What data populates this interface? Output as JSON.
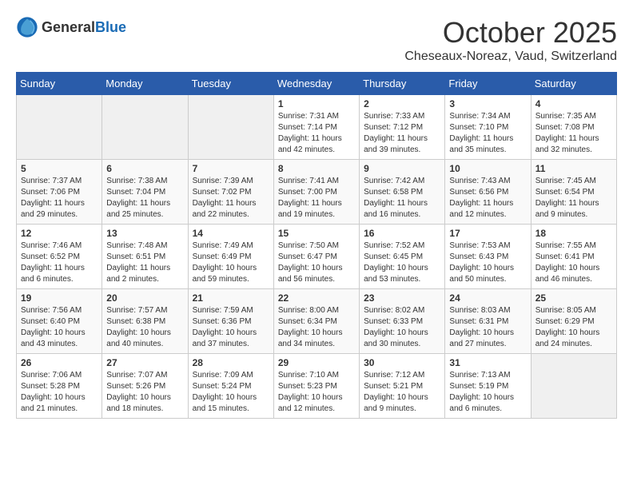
{
  "header": {
    "logo_general": "General",
    "logo_blue": "Blue",
    "month": "October 2025",
    "location": "Cheseaux-Noreaz, Vaud, Switzerland"
  },
  "weekdays": [
    "Sunday",
    "Monday",
    "Tuesday",
    "Wednesday",
    "Thursday",
    "Friday",
    "Saturday"
  ],
  "weeks": [
    [
      {
        "day": "",
        "info": ""
      },
      {
        "day": "",
        "info": ""
      },
      {
        "day": "",
        "info": ""
      },
      {
        "day": "1",
        "info": "Sunrise: 7:31 AM\nSunset: 7:14 PM\nDaylight: 11 hours\nand 42 minutes."
      },
      {
        "day": "2",
        "info": "Sunrise: 7:33 AM\nSunset: 7:12 PM\nDaylight: 11 hours\nand 39 minutes."
      },
      {
        "day": "3",
        "info": "Sunrise: 7:34 AM\nSunset: 7:10 PM\nDaylight: 11 hours\nand 35 minutes."
      },
      {
        "day": "4",
        "info": "Sunrise: 7:35 AM\nSunset: 7:08 PM\nDaylight: 11 hours\nand 32 minutes."
      }
    ],
    [
      {
        "day": "5",
        "info": "Sunrise: 7:37 AM\nSunset: 7:06 PM\nDaylight: 11 hours\nand 29 minutes."
      },
      {
        "day": "6",
        "info": "Sunrise: 7:38 AM\nSunset: 7:04 PM\nDaylight: 11 hours\nand 25 minutes."
      },
      {
        "day": "7",
        "info": "Sunrise: 7:39 AM\nSunset: 7:02 PM\nDaylight: 11 hours\nand 22 minutes."
      },
      {
        "day": "8",
        "info": "Sunrise: 7:41 AM\nSunset: 7:00 PM\nDaylight: 11 hours\nand 19 minutes."
      },
      {
        "day": "9",
        "info": "Sunrise: 7:42 AM\nSunset: 6:58 PM\nDaylight: 11 hours\nand 16 minutes."
      },
      {
        "day": "10",
        "info": "Sunrise: 7:43 AM\nSunset: 6:56 PM\nDaylight: 11 hours\nand 12 minutes."
      },
      {
        "day": "11",
        "info": "Sunrise: 7:45 AM\nSunset: 6:54 PM\nDaylight: 11 hours\nand 9 minutes."
      }
    ],
    [
      {
        "day": "12",
        "info": "Sunrise: 7:46 AM\nSunset: 6:52 PM\nDaylight: 11 hours\nand 6 minutes."
      },
      {
        "day": "13",
        "info": "Sunrise: 7:48 AM\nSunset: 6:51 PM\nDaylight: 11 hours\nand 2 minutes."
      },
      {
        "day": "14",
        "info": "Sunrise: 7:49 AM\nSunset: 6:49 PM\nDaylight: 10 hours\nand 59 minutes."
      },
      {
        "day": "15",
        "info": "Sunrise: 7:50 AM\nSunset: 6:47 PM\nDaylight: 10 hours\nand 56 minutes."
      },
      {
        "day": "16",
        "info": "Sunrise: 7:52 AM\nSunset: 6:45 PM\nDaylight: 10 hours\nand 53 minutes."
      },
      {
        "day": "17",
        "info": "Sunrise: 7:53 AM\nSunset: 6:43 PM\nDaylight: 10 hours\nand 50 minutes."
      },
      {
        "day": "18",
        "info": "Sunrise: 7:55 AM\nSunset: 6:41 PM\nDaylight: 10 hours\nand 46 minutes."
      }
    ],
    [
      {
        "day": "19",
        "info": "Sunrise: 7:56 AM\nSunset: 6:40 PM\nDaylight: 10 hours\nand 43 minutes."
      },
      {
        "day": "20",
        "info": "Sunrise: 7:57 AM\nSunset: 6:38 PM\nDaylight: 10 hours\nand 40 minutes."
      },
      {
        "day": "21",
        "info": "Sunrise: 7:59 AM\nSunset: 6:36 PM\nDaylight: 10 hours\nand 37 minutes."
      },
      {
        "day": "22",
        "info": "Sunrise: 8:00 AM\nSunset: 6:34 PM\nDaylight: 10 hours\nand 34 minutes."
      },
      {
        "day": "23",
        "info": "Sunrise: 8:02 AM\nSunset: 6:33 PM\nDaylight: 10 hours\nand 30 minutes."
      },
      {
        "day": "24",
        "info": "Sunrise: 8:03 AM\nSunset: 6:31 PM\nDaylight: 10 hours\nand 27 minutes."
      },
      {
        "day": "25",
        "info": "Sunrise: 8:05 AM\nSunset: 6:29 PM\nDaylight: 10 hours\nand 24 minutes."
      }
    ],
    [
      {
        "day": "26",
        "info": "Sunrise: 7:06 AM\nSunset: 5:28 PM\nDaylight: 10 hours\nand 21 minutes."
      },
      {
        "day": "27",
        "info": "Sunrise: 7:07 AM\nSunset: 5:26 PM\nDaylight: 10 hours\nand 18 minutes."
      },
      {
        "day": "28",
        "info": "Sunrise: 7:09 AM\nSunset: 5:24 PM\nDaylight: 10 hours\nand 15 minutes."
      },
      {
        "day": "29",
        "info": "Sunrise: 7:10 AM\nSunset: 5:23 PM\nDaylight: 10 hours\nand 12 minutes."
      },
      {
        "day": "30",
        "info": "Sunrise: 7:12 AM\nSunset: 5:21 PM\nDaylight: 10 hours\nand 9 minutes."
      },
      {
        "day": "31",
        "info": "Sunrise: 7:13 AM\nSunset: 5:19 PM\nDaylight: 10 hours\nand 6 minutes."
      },
      {
        "day": "",
        "info": ""
      }
    ]
  ]
}
